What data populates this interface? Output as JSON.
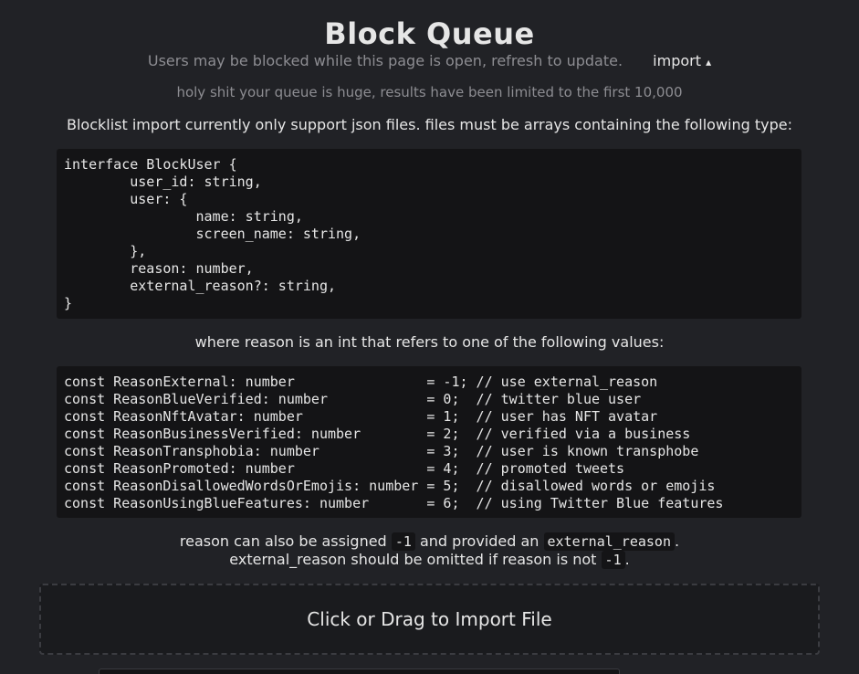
{
  "header": {
    "title": "Block Queue",
    "subtitle": "Users may be blocked while this page is open, refresh to update.",
    "import_label": "import",
    "import_caret": "▴"
  },
  "warning": "holy shit your queue is huge, results have been limited to the first 10,000",
  "import_panel": {
    "intro": "Blocklist import currently only support json files. files must be arrays containing the following type:",
    "interface_code": "interface BlockUser {\n\tuser_id: string,\n\tuser: {\n\t\tname: string,\n\t\tscreen_name: string,\n\t},\n\treason: number,\n\texternal_reason?: string,\n}",
    "reason_intro": "where reason is an int that refers to one of the following values:",
    "reasons_code": "const ReasonExternal: number                = -1; // use external_reason\nconst ReasonBlueVerified: number            = 0;  // twitter blue user\nconst ReasonNftAvatar: number               = 1;  // user has NFT avatar\nconst ReasonBusinessVerified: number        = 2;  // verified via a business\nconst ReasonTransphobia: number             = 3;  // user is known transphobe\nconst ReasonPromoted: number                = 4;  // promoted tweets\nconst ReasonDisallowedWordsOrEmojis: number = 5;  // disallowed words or emojis\nconst ReasonUsingBlueFeatures: number       = 6;  // using Twitter Blue features",
    "note": {
      "part1": "reason can also be assigned",
      "code1": "-1",
      "part2": "and provided an",
      "code2": "external_reason",
      "part3": ".",
      "part4": "external_reason should be omitted if reason is not",
      "code3": "-1",
      "part5": "."
    },
    "dropzone_label": "Click or Drag to Import File"
  }
}
